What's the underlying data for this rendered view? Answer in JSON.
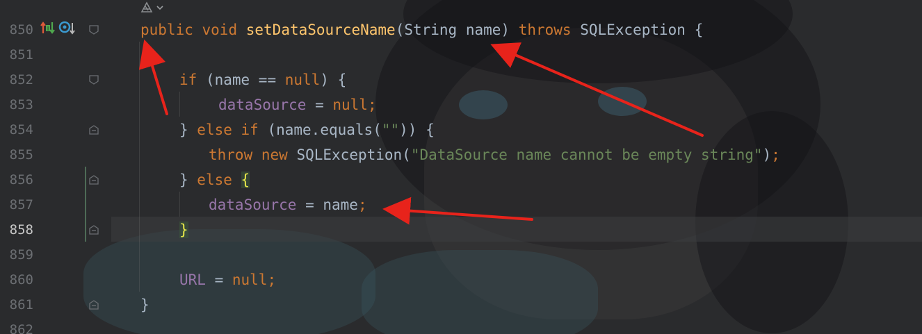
{
  "editor": {
    "lines": [
      {
        "num": "850"
      },
      {
        "num": "851"
      },
      {
        "num": "852"
      },
      {
        "num": "853"
      },
      {
        "num": "854"
      },
      {
        "num": "855"
      },
      {
        "num": "856"
      },
      {
        "num": "857"
      },
      {
        "num": "858"
      },
      {
        "num": "859"
      },
      {
        "num": "860"
      },
      {
        "num": "861"
      },
      {
        "num": "862"
      }
    ],
    "current_line": "858",
    "code": {
      "l850": {
        "public": "public",
        "void": "void",
        "name": "setDataSourceName",
        "params_open": "(String name) ",
        "throws": "throws",
        "rest": " SQLException {"
      },
      "l852": {
        "if": "if",
        "rest": " (name == ",
        "null": "null",
        "close": ") {"
      },
      "l853": {
        "field": "dataSource",
        "eq": " = ",
        "null": "null",
        "semi": ";"
      },
      "l854": {
        "close": "} ",
        "else": "else",
        "sp": " ",
        "if": "if",
        "rest": " (name.equals(",
        "str": "\"\"",
        "end": ")) {"
      },
      "l855": {
        "throw": "throw",
        "sp": " ",
        "new": "new",
        "cls": " SQLException(",
        "str": "\"DataSource name cannot be empty string\"",
        "end": ")",
        "semi": ";"
      },
      "l856": {
        "close": "} ",
        "else": "else",
        "sp": " ",
        "brace": "{"
      },
      "l857": {
        "field": "dataSource",
        "rest": " = name",
        "semi": ";"
      },
      "l858": {
        "brace": "}"
      },
      "l860": {
        "field": "URL",
        "eq": " = ",
        "null": "null",
        "semi": ";"
      },
      "l861": {
        "brace": "}"
      }
    }
  },
  "icons": {
    "override": "override-icon",
    "implement": "implement-icon",
    "lens": "ai-assistant-icon"
  },
  "colors": {
    "keyword": "#cc7832",
    "function": "#ffc66d",
    "field": "#9876aa",
    "string": "#6a8759",
    "text": "#a9b7c6",
    "annotation_arrow": "#e8231b"
  }
}
